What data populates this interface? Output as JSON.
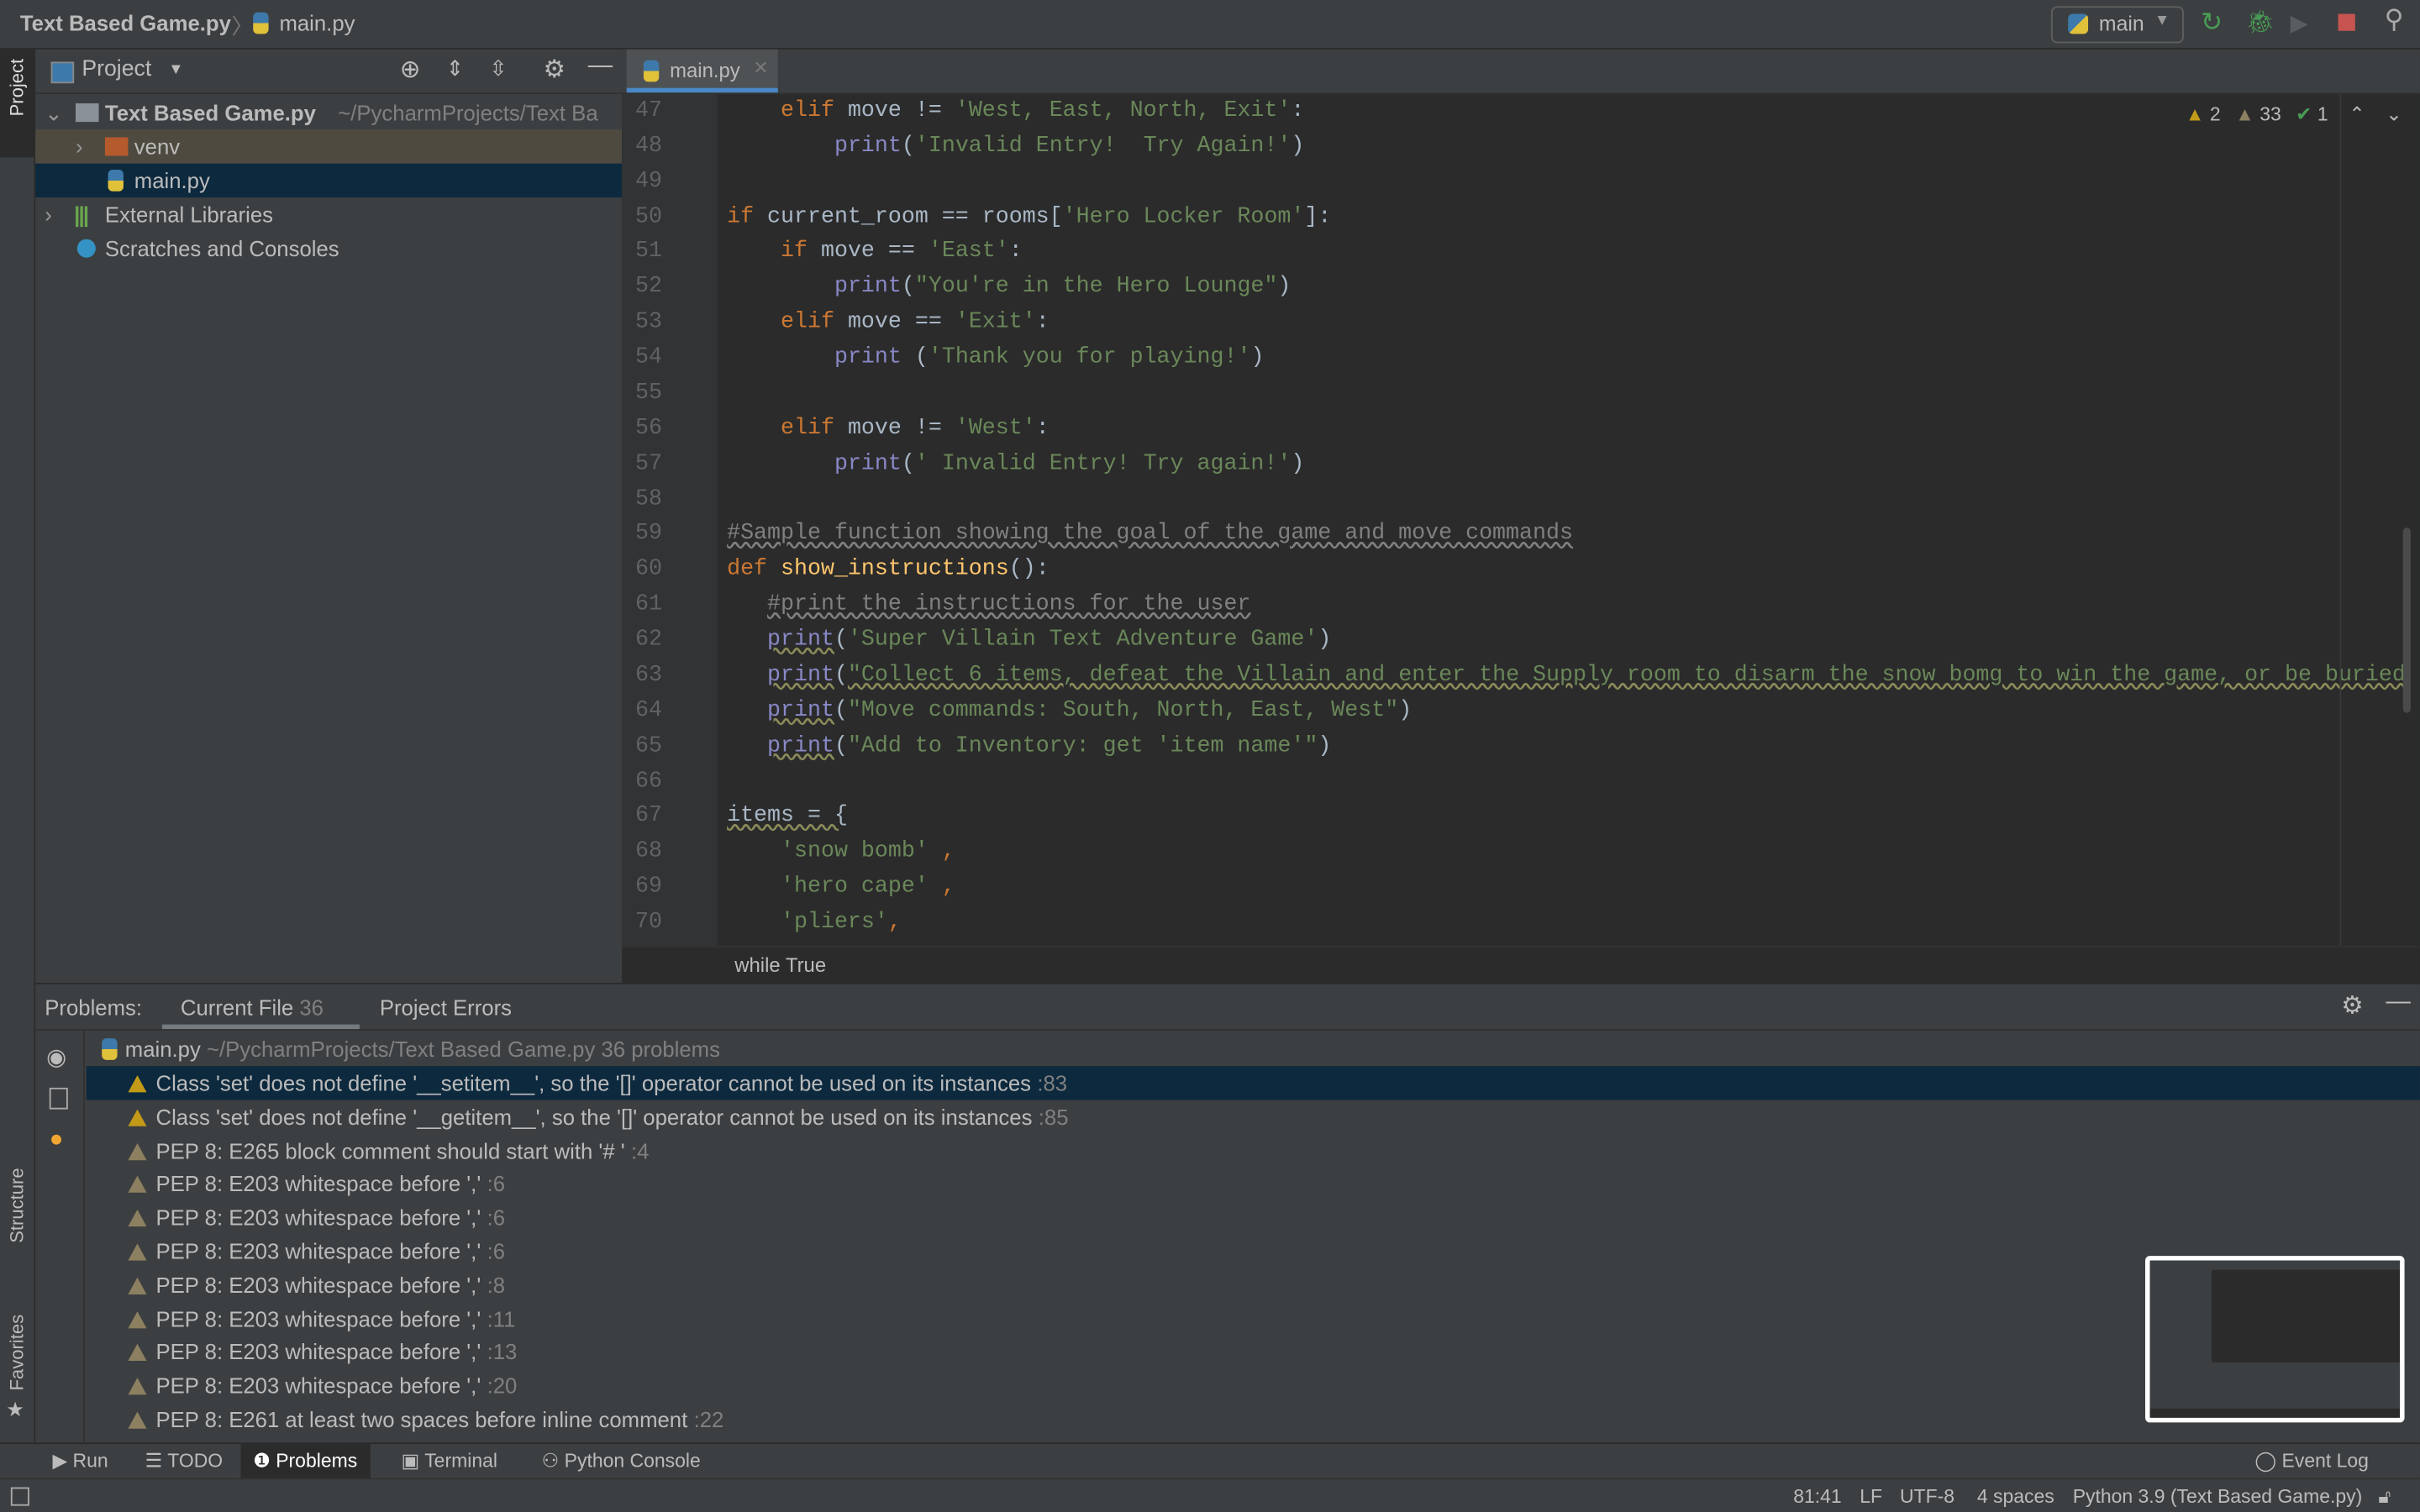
{
  "titlebar": {
    "project": "Text Based Game.py",
    "file": "main.py",
    "run_config": "main"
  },
  "colors": {
    "accent": "#4a88c7",
    "keyword": "#cc7832",
    "string": "#6a8759",
    "comment": "#808080",
    "builtin": "#8888c6",
    "function": "#ffc66d",
    "stop": "#c75450",
    "run_green": "#499c54",
    "warning": "#c29a18"
  },
  "left_stripe": {
    "project": "Project",
    "structure": "Structure",
    "favorites": "Favorites"
  },
  "project_panel": {
    "title": "Project",
    "tree": [
      {
        "label": "Text Based Game.py",
        "path": "~/PycharmProjects/Text Ba",
        "icon": "folder-icon"
      },
      {
        "label": "venv",
        "icon": "folder-icon"
      },
      {
        "label": "main.py",
        "icon": "python-file-icon"
      },
      {
        "label": "External Libraries",
        "icon": "library-icon"
      },
      {
        "label": "Scratches and Consoles",
        "icon": "scratches-icon"
      }
    ]
  },
  "editor": {
    "tab": "main.py",
    "inspection": {
      "warnings": "2",
      "weak_warnings": "33",
      "typos": "1"
    },
    "breadcrumb": "while True",
    "lines": [
      {
        "n": "47",
        "t": [
          [
            "pl",
            "    "
          ],
          [
            "kw",
            "elif"
          ],
          [
            "pl",
            " move != "
          ],
          [
            "str",
            "'West, East, North, Exit'"
          ],
          [
            "pl",
            ":"
          ]
        ]
      },
      {
        "n": "48",
        "t": [
          [
            "pl",
            "        "
          ],
          [
            "bi",
            "print"
          ],
          [
            "pl",
            "("
          ],
          [
            "str",
            "'Invalid Entry!  Try Again!'"
          ],
          [
            "pl",
            ")"
          ]
        ]
      },
      {
        "n": "49",
        "t": []
      },
      {
        "n": "50",
        "t": [
          [
            "kw",
            "if"
          ],
          [
            "pl",
            " current_room == rooms["
          ],
          [
            "str",
            "'Hero Locker Room'"
          ],
          [
            "pl",
            "]:"
          ]
        ]
      },
      {
        "n": "51",
        "t": [
          [
            "pl",
            "    "
          ],
          [
            "kw",
            "if"
          ],
          [
            "pl",
            " move == "
          ],
          [
            "str",
            "'East'"
          ],
          [
            "pl",
            ":"
          ]
        ]
      },
      {
        "n": "52",
        "t": [
          [
            "pl",
            "        "
          ],
          [
            "bi",
            "print"
          ],
          [
            "pl",
            "("
          ],
          [
            "str",
            "\"You're in the Hero Lounge\""
          ],
          [
            "pl",
            ")"
          ]
        ]
      },
      {
        "n": "53",
        "t": [
          [
            "pl",
            "    "
          ],
          [
            "kw",
            "elif"
          ],
          [
            "pl",
            " move == "
          ],
          [
            "str",
            "'Exit'"
          ],
          [
            "pl",
            ":"
          ]
        ]
      },
      {
        "n": "54",
        "t": [
          [
            "pl",
            "        "
          ],
          [
            "bi",
            "print"
          ],
          [
            "pl",
            " ("
          ],
          [
            "str",
            "'Thank you for playing!'"
          ],
          [
            "pl",
            ")"
          ]
        ]
      },
      {
        "n": "55",
        "t": []
      },
      {
        "n": "56",
        "t": [
          [
            "pl",
            "    "
          ],
          [
            "kw",
            "elif"
          ],
          [
            "pl",
            " move != "
          ],
          [
            "str",
            "'West'"
          ],
          [
            "pl",
            ":"
          ]
        ]
      },
      {
        "n": "57",
        "t": [
          [
            "pl",
            "        "
          ],
          [
            "bi",
            "print"
          ],
          [
            "pl",
            "("
          ],
          [
            "str",
            "' Invalid Entry! Try again!'"
          ],
          [
            "pl",
            ")"
          ]
        ]
      },
      {
        "n": "58",
        "t": []
      },
      {
        "n": "59",
        "t": [
          [
            "cm",
            "#Sample function showing the goal of the game and move commands"
          ]
        ]
      },
      {
        "n": "60",
        "t": [
          [
            "kw",
            "def "
          ],
          [
            "fn",
            "show_instructions"
          ],
          [
            "pl",
            "():"
          ]
        ]
      },
      {
        "n": "61",
        "t": [
          [
            "pl",
            "   "
          ],
          [
            "cm",
            "#print the instructions for the user"
          ]
        ]
      },
      {
        "n": "62",
        "t": [
          [
            "pl",
            "   "
          ],
          [
            "bi u",
            "print"
          ],
          [
            "pl",
            "("
          ],
          [
            "str",
            "'Super Villain Text Adventure Game'"
          ],
          [
            "pl",
            ")"
          ]
        ]
      },
      {
        "n": "63",
        "t": [
          [
            "pl",
            "   "
          ],
          [
            "bi u",
            "print"
          ],
          [
            "pl",
            "("
          ],
          [
            "str u",
            "\"Collect 6 items, defeat the Villain and enter the Supply room to disarm the snow bomg to win the game, or be buried"
          ]
        ]
      },
      {
        "n": "64",
        "t": [
          [
            "pl",
            "   "
          ],
          [
            "bi u",
            "print"
          ],
          [
            "pl",
            "("
          ],
          [
            "str",
            "\"Move commands: South, North, East, West\""
          ],
          [
            "pl",
            ")"
          ]
        ]
      },
      {
        "n": "65",
        "t": [
          [
            "pl",
            "   "
          ],
          [
            "bi u",
            "print"
          ],
          [
            "pl",
            "("
          ],
          [
            "str",
            "\"Add to Inventory: get 'item name'\""
          ],
          [
            "pl",
            ")"
          ]
        ]
      },
      {
        "n": "66",
        "t": []
      },
      {
        "n": "67",
        "t": [
          [
            "pl u",
            "items = {"
          ]
        ]
      },
      {
        "n": "68",
        "t": [
          [
            "pl",
            "    "
          ],
          [
            "str",
            "'snow bomb'"
          ],
          [
            "kw",
            " ,"
          ]
        ]
      },
      {
        "n": "69",
        "t": [
          [
            "pl",
            "    "
          ],
          [
            "str",
            "'hero cape'"
          ],
          [
            "kw",
            " ,"
          ]
        ]
      },
      {
        "n": "70",
        "t": [
          [
            "pl",
            "    "
          ],
          [
            "str",
            "'pliers'"
          ],
          [
            "kw",
            ","
          ]
        ]
      }
    ]
  },
  "problems": {
    "label": "Problems:",
    "tabs": [
      {
        "label": "Current File",
        "count": "36"
      },
      {
        "label": "Project Errors"
      }
    ],
    "file": {
      "name": "main.py",
      "path": "~/PycharmProjects/Text Based Game.py",
      "count": "36 problems"
    },
    "items": [
      {
        "text": "Class 'set' does not define '__setitem__', so the '[]' operator cannot be used on its instances",
        "line": ":83",
        "severity": "warning"
      },
      {
        "text": "Class 'set' does not define '__getitem__', so the '[]' operator cannot be used on its instances",
        "line": ":85",
        "severity": "warning"
      },
      {
        "text": "PEP 8: E265 block comment should start with '# '",
        "line": ":4",
        "severity": "weak"
      },
      {
        "text": "PEP 8: E203 whitespace before ','",
        "line": ":6",
        "severity": "weak"
      },
      {
        "text": "PEP 8: E203 whitespace before ','",
        "line": ":6",
        "severity": "weak"
      },
      {
        "text": "PEP 8: E203 whitespace before ','",
        "line": ":6",
        "severity": "weak"
      },
      {
        "text": "PEP 8: E203 whitespace before ','",
        "line": ":8",
        "severity": "weak"
      },
      {
        "text": "PEP 8: E203 whitespace before ','",
        "line": ":11",
        "severity": "weak"
      },
      {
        "text": "PEP 8: E203 whitespace before ','",
        "line": ":13",
        "severity": "weak"
      },
      {
        "text": "PEP 8: E203 whitespace before ','",
        "line": ":20",
        "severity": "weak"
      },
      {
        "text": "PEP 8: E261 at least two spaces before inline comment",
        "line": ":22",
        "severity": "weak"
      }
    ]
  },
  "tool_windows": {
    "run": "Run",
    "todo": "TODO",
    "problems": "Problems",
    "terminal": "Terminal",
    "python_console": "Python Console",
    "event_log": "Event Log"
  },
  "status": {
    "position": "81:41",
    "line_sep": "LF",
    "encoding": "UTF-8",
    "indent": "4 spaces",
    "interpreter": "Python 3.9 (Text Based Game.py)"
  }
}
